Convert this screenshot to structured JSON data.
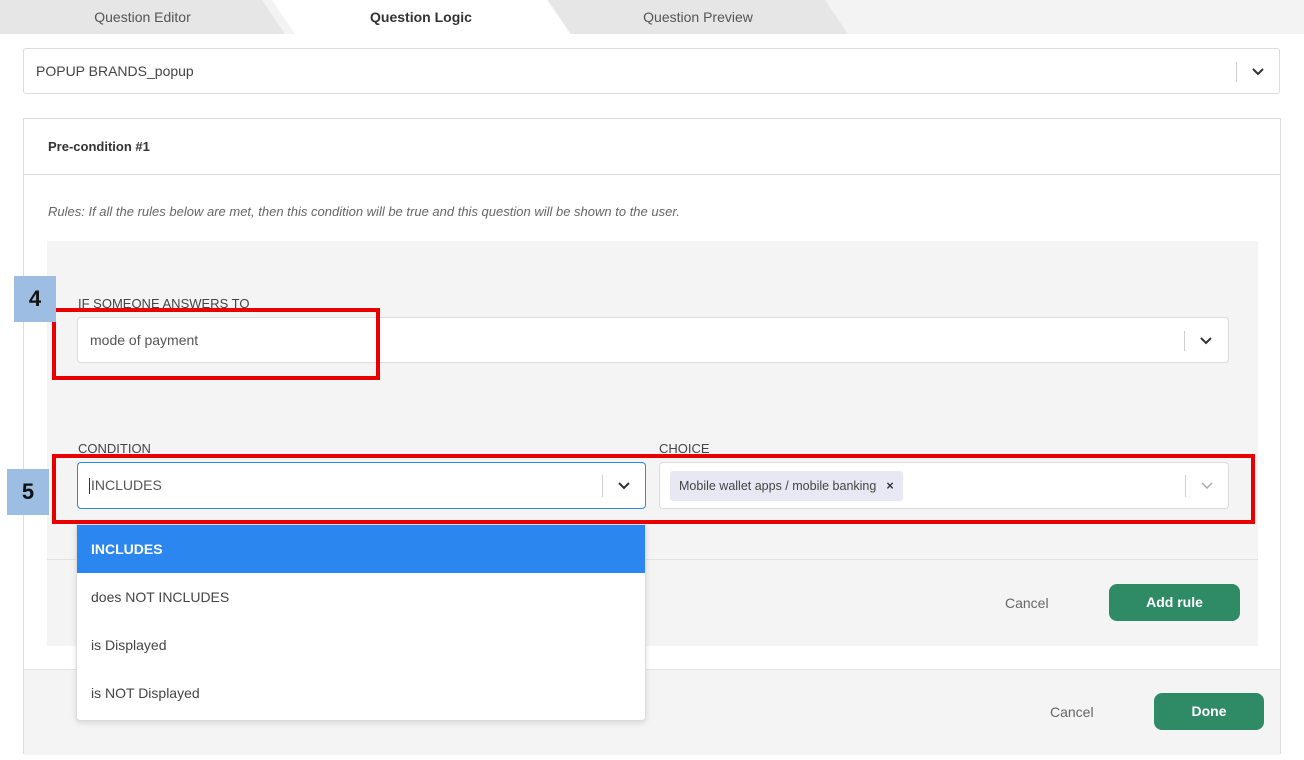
{
  "tabs": [
    {
      "label": "Question Editor",
      "active": false
    },
    {
      "label": "Question Logic",
      "active": true
    },
    {
      "label": "Question Preview",
      "active": false
    }
  ],
  "question_select": {
    "value": "POPUP BRANDS_popup",
    "icon": "chevron-down-icon"
  },
  "precondition": {
    "title": "Pre-condition #1",
    "rules_text": "Rules: If all the rules below are met, then this condition will be true and this question will be shown to the user.",
    "if_label": "IF SOMEONE ANSWERS TO",
    "if_value": "mode of payment",
    "condition_label": "CONDITION",
    "condition_value": "INCLUDES",
    "choice_label": "CHOICE",
    "choice_tag": "Mobile wallet apps / mobile banking",
    "choice_tag_remove": "×",
    "cancel_label": "Cancel",
    "add_rule_label": "Add rule"
  },
  "condition_options": [
    {
      "label": "INCLUDES",
      "selected": true
    },
    {
      "label": "does NOT INCLUDES",
      "selected": false
    },
    {
      "label": "is Displayed",
      "selected": false
    },
    {
      "label": "is NOT Displayed",
      "selected": false
    }
  ],
  "footer": {
    "cancel_label": "Cancel",
    "done_label": "Done"
  },
  "annotations": [
    {
      "number": "4"
    },
    {
      "number": "5"
    }
  ],
  "colors": {
    "accent_green": "#2e8b66",
    "selected_blue": "#2b86f0",
    "annotation_red": "#e60000",
    "annotation_badge": "#9dbde3"
  }
}
